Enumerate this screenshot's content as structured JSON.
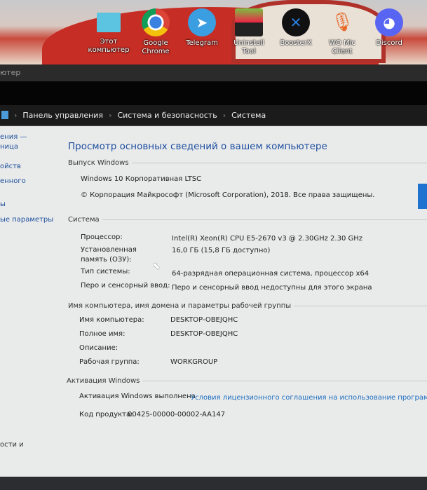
{
  "desktop": {
    "icons": [
      {
        "label": "Этот компьютер",
        "icon": "monitor-icon"
      },
      {
        "label": "Google Chrome",
        "icon": "chrome-icon"
      },
      {
        "label": "Telegram",
        "icon": "telegram-icon"
      },
      {
        "label": "Uninstall Tool",
        "icon": "uninstall-tool-icon"
      },
      {
        "label": "BoosterX",
        "icon": "boosterx-icon"
      },
      {
        "label": "WO Mic Client",
        "icon": "microphone-icon"
      },
      {
        "label": "Discord",
        "icon": "discord-icon"
      }
    ]
  },
  "window": {
    "title": "ютер"
  },
  "breadcrumb": [
    "Панель управления",
    "Система и безопасность",
    "Система"
  ],
  "sidebar": [
    "ения —",
    "ница",
    "ойств",
    "енного",
    "ы",
    "ые параметры",
    "ости и"
  ],
  "main": {
    "title": "Просмотр основных сведений о вашем компьютере",
    "edition": {
      "heading": "Выпуск Windows",
      "name": "Windows 10 Корпоративная LTSC",
      "copyright": "© Корпорация Майкрософт (Microsoft Corporation), 2018. Все права защищены."
    },
    "system": {
      "heading": "Система",
      "rows": [
        {
          "label": "Процессор:",
          "value": "Intel(R) Xeon(R) CPU E5-2670 v3 @ 2.30GHz   2.30 GHz"
        },
        {
          "label": "Установленная память (ОЗУ):",
          "value": "16,0 ГБ (15,8 ГБ доступно)"
        },
        {
          "label": "Тип системы:",
          "value": "64-разрядная операционная система, процессор x64"
        },
        {
          "label": "Перо и сенсорный ввод:",
          "value": "Перо и сенсорный ввод недоступны для этого экрана"
        }
      ]
    },
    "computer": {
      "heading": "Имя компьютера, имя домена и параметры рабочей группы",
      "rows": [
        {
          "label": "Имя компьютера:",
          "value": "DESKTOP-OBEJQHC"
        },
        {
          "label": "Полное имя:",
          "value": "DESKTOP-OBEJQHC"
        },
        {
          "label": "Описание:",
          "value": ""
        },
        {
          "label": "Рабочая группа:",
          "value": "WORKGROUP"
        }
      ]
    },
    "activation": {
      "heading": "Активация Windows",
      "status": "Активация Windows выполнена",
      "link": "Условия лицензионного соглашения на использование программно",
      "product_label": "Код продукта:",
      "product_key": "00425-00000-00002-AA147"
    }
  }
}
